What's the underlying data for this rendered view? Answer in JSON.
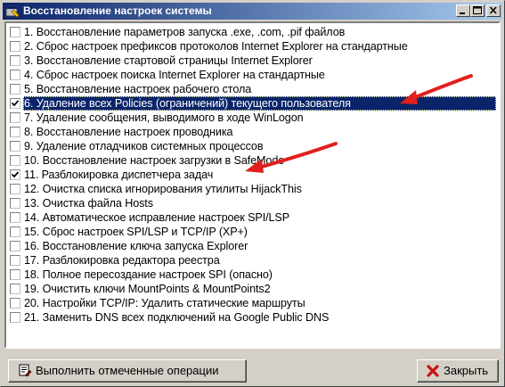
{
  "window": {
    "title": "Восстановление настроек системы"
  },
  "items": [
    {
      "label": "1. Восстановление параметров запуска .exe, .com, .pif файлов",
      "checked": false,
      "selected": false
    },
    {
      "label": "2. Сброс настроек префиксов протоколов Internet Explorer на стандартные",
      "checked": false,
      "selected": false
    },
    {
      "label": "3. Восстановление стартовой страницы Internet Explorer",
      "checked": false,
      "selected": false
    },
    {
      "label": "4. Сброс настроек поиска Internet Explorer на стандартные",
      "checked": false,
      "selected": false
    },
    {
      "label": "5. Восстановление настроек рабочего стола",
      "checked": false,
      "selected": false
    },
    {
      "label": "6. Удаление всех Policies (ограничений) текущего пользователя",
      "checked": true,
      "selected": true
    },
    {
      "label": "7. Удаление сообщения, выводимого в ходе WinLogon",
      "checked": false,
      "selected": false
    },
    {
      "label": "8. Восстановление настроек проводника",
      "checked": false,
      "selected": false
    },
    {
      "label": "9. Удаление отладчиков системных процессов",
      "checked": false,
      "selected": false
    },
    {
      "label": "10. Восстановление настроек загрузки в SafeMode",
      "checked": false,
      "selected": false
    },
    {
      "label": "11. Разблокировка диспетчера задач",
      "checked": true,
      "selected": false
    },
    {
      "label": "12. Очистка списка игнорирования утилиты HijackThis",
      "checked": false,
      "selected": false
    },
    {
      "label": "13. Очистка файла Hosts",
      "checked": false,
      "selected": false
    },
    {
      "label": "14. Автоматическое исправление настроек SPI/LSP",
      "checked": false,
      "selected": false
    },
    {
      "label": "15. Сброс настроек SPI/LSP и TCP/IP (XP+)",
      "checked": false,
      "selected": false
    },
    {
      "label": "16. Восстановление ключа запуска Explorer",
      "checked": false,
      "selected": false
    },
    {
      "label": "17. Разблокировка редактора реестра",
      "checked": false,
      "selected": false
    },
    {
      "label": "18. Полное пересоздание настроек SPI (опасно)",
      "checked": false,
      "selected": false
    },
    {
      "label": "19. Очистить ключи MountPoints & MountPoints2",
      "checked": false,
      "selected": false
    },
    {
      "label": "20. Настройки TCP/IP: Удалить статические маршруты",
      "checked": false,
      "selected": false
    },
    {
      "label": "21. Заменить DNS всех подключений на Google Public DNS",
      "checked": false,
      "selected": false
    }
  ],
  "buttons": {
    "run_label": "Выполнить отмеченные операции",
    "close_label": "Закрыть"
  },
  "colors": {
    "titlebar_start": "#0a246a",
    "titlebar_end": "#a6caf0",
    "selection": "#0a246a",
    "annotation_arrow": "#e0201c",
    "close_icon": "#cc1111"
  },
  "icons": {
    "app": "app-settings-icon",
    "run": "run-operations-icon",
    "close": "red-x-icon"
  }
}
